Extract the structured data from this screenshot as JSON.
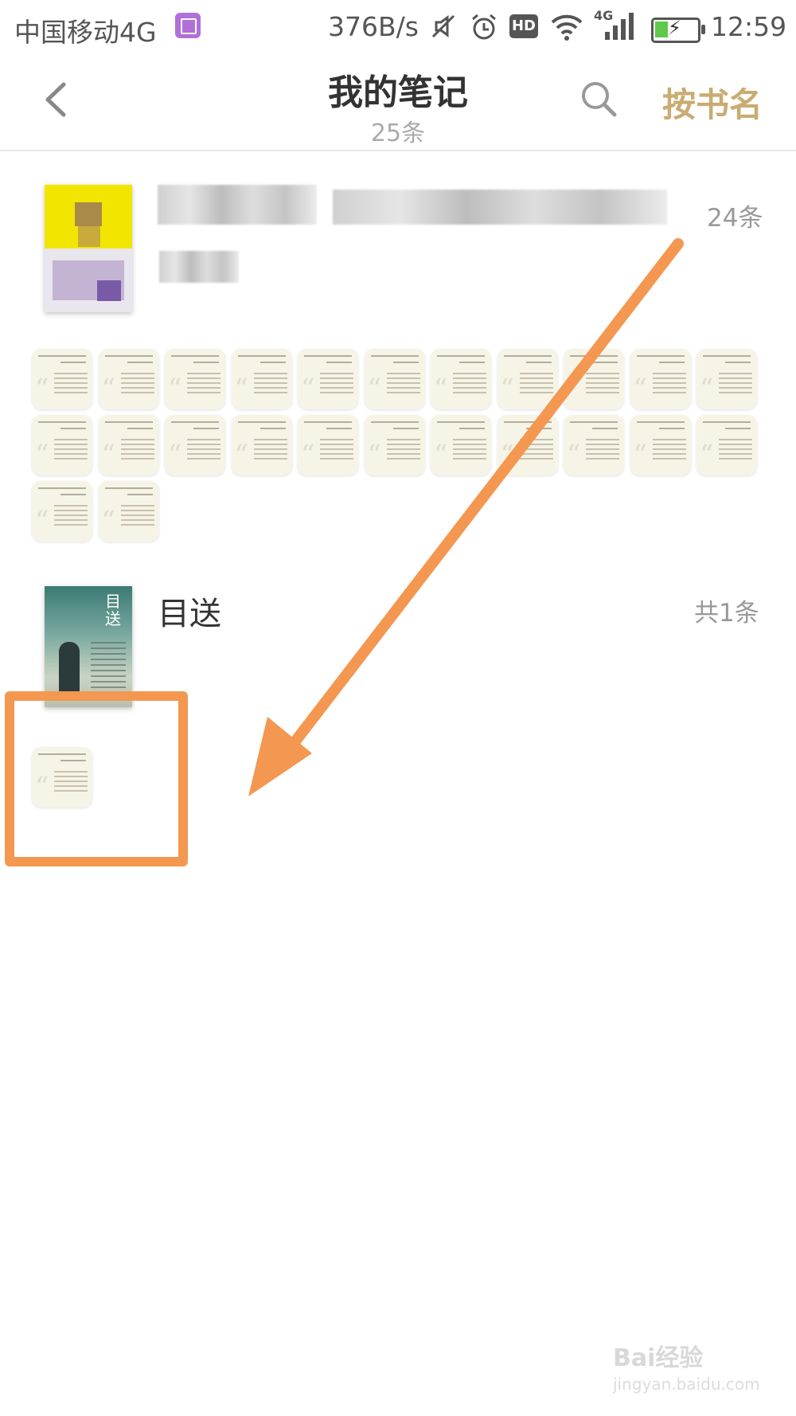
{
  "status_bar": {
    "carrier": "中国移动4G",
    "speed": "376B/s",
    "hd_label": "HD",
    "network": "4G",
    "time": "12:59",
    "icons": [
      "image-icon",
      "mute-icon",
      "alarm-icon",
      "hd-icon",
      "wifi-icon",
      "signal-icon",
      "battery-icon"
    ]
  },
  "header": {
    "title": "我的笔记",
    "subtitle": "25条",
    "sort_label": "按书名",
    "icons": [
      "back-arrow-icon",
      "search-icon"
    ]
  },
  "books": [
    {
      "title_obscured": true,
      "count": "24条",
      "note_count": 24
    },
    {
      "title": "目送",
      "count": "共1条",
      "note_count": 1
    }
  ],
  "annotation": {
    "color": "#f49750"
  },
  "watermark": {
    "text": "Bai经验",
    "url_text": "jingyan.baidu.com"
  },
  "colors": {
    "accent": "#c8ac72",
    "annotation": "#f49750",
    "card_bg": "#f6f4e7"
  }
}
